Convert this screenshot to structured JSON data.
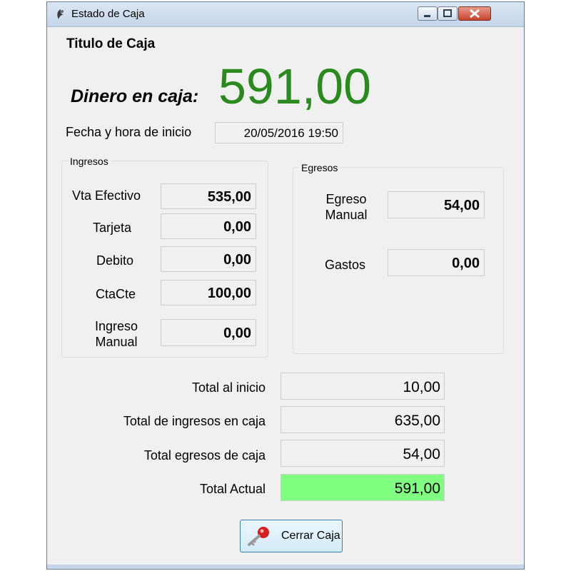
{
  "window": {
    "title": "Estado de Caja"
  },
  "header": {
    "caja_title": "Titulo de Caja",
    "dinero_label": "Dinero en caja:",
    "dinero_value": "591,00"
  },
  "fecha": {
    "label": "Fecha y hora de inicio",
    "value": "20/05/2016 19:50"
  },
  "ingresos": {
    "legend": "Ingresos",
    "rows": [
      {
        "label": "Vta Efectivo",
        "value": "535,00"
      },
      {
        "label": "Tarjeta",
        "value": "0,00"
      },
      {
        "label": "Debito",
        "value": "0,00"
      },
      {
        "label": "CtaCte",
        "value": "100,00"
      },
      {
        "label_line1": "Ingreso",
        "label_line2": "Manual",
        "value": "0,00"
      }
    ]
  },
  "egresos": {
    "legend": "Egresos",
    "rows": [
      {
        "label_line1": "Egreso",
        "label_line2": "Manual",
        "value": "54,00"
      },
      {
        "label": "Gastos",
        "value": "0,00"
      }
    ]
  },
  "totals": [
    {
      "label": "Total al inicio",
      "value": "10,00"
    },
    {
      "label": "Total de ingresos en caja",
      "value": "635,00"
    },
    {
      "label": "Total egresos de caja",
      "value": "54,00"
    },
    {
      "label": "Total Actual",
      "value": "591,00"
    }
  ],
  "colors": {
    "dinero": "#2a8a1e",
    "total_actual_bg": "#80ff80"
  },
  "close_button": {
    "label": "Cerrar Caja",
    "icon": "key-icon"
  }
}
